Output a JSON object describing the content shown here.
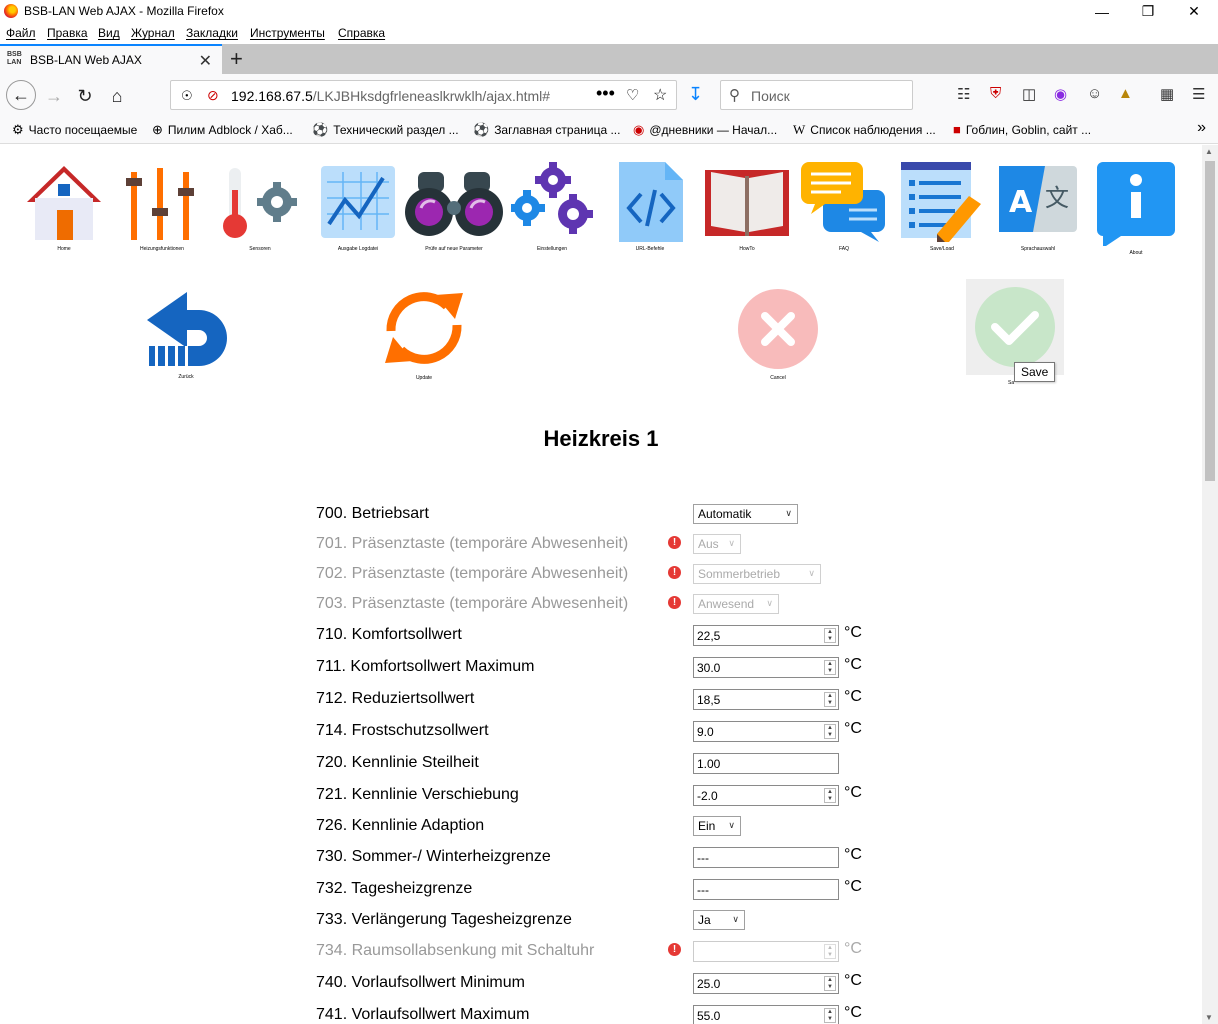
{
  "window": {
    "title": "BSB-LAN Web AJAX - Mozilla Firefox",
    "minimize": "—",
    "maximize": "❐",
    "close": "✕"
  },
  "menu": [
    "Файл",
    "Правка",
    "Вид",
    "Журнал",
    "Закладки",
    "Инструменты",
    "Справка"
  ],
  "tab": {
    "title": "BSB-LAN Web AJAX",
    "favicon": "BSB\nLAN",
    "close": "✕",
    "new": "+"
  },
  "address": {
    "host": "192.168.67.5",
    "path": "/LKJBHksdgfrleneaslkrwklh/ajax.html#",
    "more": "•••"
  },
  "search": {
    "placeholder": "Поиск"
  },
  "bookmarks": [
    {
      "icon": "gear-icon",
      "glyph": "⚙",
      "label": "Часто посещаемые"
    },
    {
      "icon": "globe-icon",
      "glyph": "⊕",
      "label": "Пилим Adblock / Хаб..."
    },
    {
      "icon": "ball-icon",
      "glyph": "⚽",
      "label": "Технический раздел ..."
    },
    {
      "icon": "ball-icon",
      "glyph": "⚽",
      "label": "Заглавная страница ..."
    },
    {
      "icon": "diary-icon",
      "glyph": "◉",
      "label": "@дневники — Начал..."
    },
    {
      "icon": "wikipedia-icon",
      "glyph": "W",
      "label": "Список наблюдения ..."
    },
    {
      "icon": "goblin-icon",
      "glyph": "■",
      "label": "Гоблин, Goblin, сайт ..."
    }
  ],
  "top_icons": [
    {
      "name": "home",
      "label": "Home"
    },
    {
      "name": "heating-functions",
      "label": "Heizungsfunktionen"
    },
    {
      "name": "sensors",
      "label": "Sensoren"
    },
    {
      "name": "logfile",
      "label": "Ausgabe Logdatei"
    },
    {
      "name": "check-new-params",
      "label": "Prüfe auf neue Parameter"
    },
    {
      "name": "settings",
      "label": "Einstellungen"
    },
    {
      "name": "url-commands",
      "label": "URL-Befehle"
    },
    {
      "name": "howto",
      "label": "HowTo"
    },
    {
      "name": "faq",
      "label": "FAQ"
    },
    {
      "name": "save-load",
      "label": "Save/Load"
    },
    {
      "name": "language",
      "label": "Sprachauswahl"
    },
    {
      "name": "about",
      "label": "About"
    }
  ],
  "action_icons": [
    {
      "name": "back",
      "label": "Zurück"
    },
    {
      "name": "update",
      "label": "Update"
    },
    {
      "name": "cancel",
      "label": "Cancel"
    },
    {
      "name": "save",
      "label": "Sa"
    }
  ],
  "tooltip": "Save",
  "heading": "Heizkreis 1",
  "params": [
    {
      "label": "700. Betriebsart",
      "type": "select",
      "value": "Automatik",
      "disabled": false,
      "warn": false
    },
    {
      "label": "701. Präsenztaste (temporäre Abwesenheit)",
      "type": "select",
      "value": "Aus",
      "disabled": true,
      "warn": true
    },
    {
      "label": "702. Präsenztaste (temporäre Abwesenheit)",
      "type": "select",
      "value": "Sommerbetrieb",
      "disabled": true,
      "warn": true
    },
    {
      "label": "703. Präsenztaste (temporäre Abwesenheit)",
      "type": "select",
      "value": "Anwesend",
      "disabled": true,
      "warn": true
    },
    {
      "label": "710. Komfortsollwert",
      "type": "number",
      "value": "22,5",
      "unit": "°C",
      "disabled": false,
      "warn": false
    },
    {
      "label": "711. Komfortsollwert Maximum",
      "type": "number",
      "value": "30.0",
      "unit": "°C",
      "disabled": false,
      "warn": false
    },
    {
      "label": "712. Reduziertsollwert",
      "type": "number",
      "value": "18,5",
      "unit": "°C",
      "disabled": false,
      "warn": false
    },
    {
      "label": "714. Frostschutzsollwert",
      "type": "number",
      "value": "9.0",
      "unit": "°C",
      "disabled": false,
      "warn": false
    },
    {
      "label": "720. Kennlinie Steilheit",
      "type": "number",
      "value": "1.00",
      "unit": "",
      "disabled": false,
      "warn": false,
      "nospin": true
    },
    {
      "label": "721. Kennlinie Verschiebung",
      "type": "number",
      "value": "-2.0",
      "unit": "°C",
      "disabled": false,
      "warn": false
    },
    {
      "label": "726. Kennlinie Adaption",
      "type": "select",
      "value": "Ein",
      "disabled": false,
      "warn": false
    },
    {
      "label": "730. Sommer-/ Winterheizgrenze",
      "type": "text",
      "value": "---",
      "unit": "°C",
      "disabled": false,
      "warn": false
    },
    {
      "label": "732. Tagesheizgrenze",
      "type": "text",
      "value": "---",
      "unit": "°C",
      "disabled": false,
      "warn": false
    },
    {
      "label": "733. Verlängerung Tagesheizgrenze",
      "type": "select",
      "value": "Ja",
      "disabled": false,
      "warn": false
    },
    {
      "label": "734. Raumsollabsenkung mit Schaltuhr",
      "type": "number",
      "value": "",
      "unit": "°C",
      "disabled": true,
      "warn": true
    },
    {
      "label": "740. Vorlaufsollwert Minimum",
      "type": "number",
      "value": "25.0",
      "unit": "°C",
      "disabled": false,
      "warn": false
    },
    {
      "label": "741. Vorlaufsollwert Maximum",
      "type": "number",
      "value": "55.0",
      "unit": "°C",
      "disabled": false,
      "warn": false
    }
  ],
  "colors": {
    "accent": "#0a84ff",
    "warning": "#e53935",
    "disabled_text": "#999999"
  }
}
